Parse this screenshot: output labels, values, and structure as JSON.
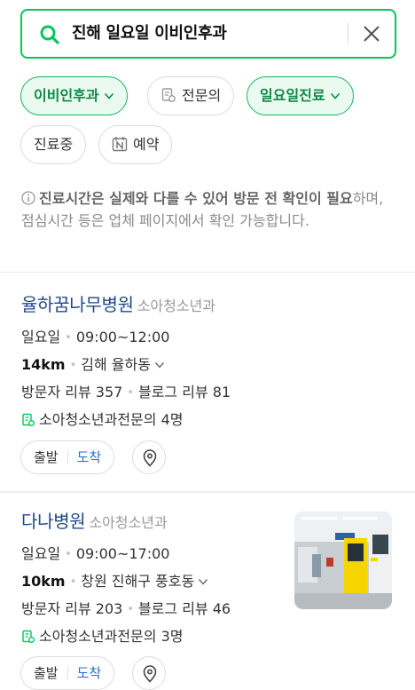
{
  "search": {
    "query": "진해 일요일 이비인후과"
  },
  "filters": {
    "chips": [
      {
        "label": "이비인후과"
      },
      {
        "label": "전문의"
      },
      {
        "label": "일요일진료"
      },
      {
        "label": "진료중"
      },
      {
        "label": "예약"
      }
    ]
  },
  "notice": {
    "bold": "진료시간은 실제와 다를 수 있어 방문 전 확인이 필요",
    "rest": "하며, 점심시간 등은 업체 페이지에서 확인 가능합니다."
  },
  "results": [
    {
      "name": "율하꿈나무병원",
      "category": "소아청소년과",
      "day": "일요일",
      "hours": "09:00~12:00",
      "distance": "14km",
      "address": "김해 율하동",
      "visitor_reviews": "방문자 리뷰 357",
      "blog_reviews": "블로그 리뷰 81",
      "specialists": "소아청소년과전문의 4명",
      "start_label": "출발",
      "arrive_label": "도착"
    },
    {
      "name": "다나병원",
      "category": "소아청소년과",
      "day": "일요일",
      "hours": "09:00~17:00",
      "distance": "10km",
      "address": "창원 진해구 풍호동",
      "visitor_reviews": "방문자 리뷰 203",
      "blog_reviews": "블로그 리뷰 46",
      "specialists": "소아청소년과전문의 3명",
      "start_label": "출발",
      "arrive_label": "도착"
    }
  ],
  "colors": {
    "brand_green": "#03c75a",
    "link_blue": "#1f4a8a",
    "arrive_blue": "#1f6fd6"
  }
}
